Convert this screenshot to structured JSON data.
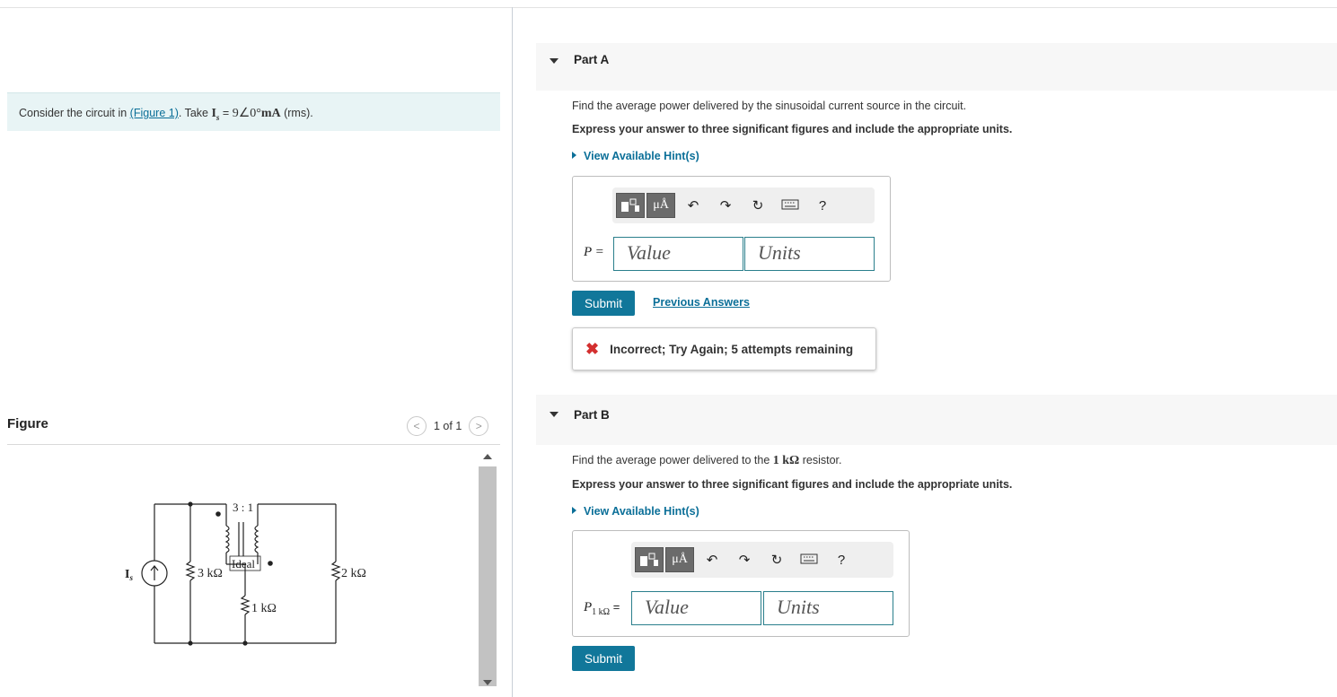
{
  "problem": {
    "intro": "Consider the circuit in ",
    "figure_link": "(Figure 1)",
    "take": ". Take ",
    "symbol": "I",
    "symbol_sub": "s",
    "equals": " = ",
    "phasor": "9∠0°",
    "unit": "mA",
    "rms": " (rms)."
  },
  "figure": {
    "title": "Figure",
    "pager_text": "1 of 1",
    "prev_glyph": "<",
    "next_glyph": ">",
    "circuit_labels": {
      "source": "I",
      "source_sub": "s",
      "r1": "3 kΩ",
      "ratio": "3 : 1",
      "ideal": "Ideal",
      "r2": "2 kΩ",
      "r3": "1 kΩ"
    }
  },
  "partA": {
    "title": "Part A",
    "question": "Find the average power delivered by the sinusoidal current source in the circuit.",
    "express": "Express your answer to three significant figures and include the appropriate units.",
    "hint": "View Available Hint(s)",
    "var_label": "P =",
    "value_placeholder": "Value",
    "units_placeholder": "Units",
    "submit": "Submit",
    "previous_answers": "Previous Answers",
    "feedback_icon": "✖",
    "feedback": "Incorrect; Try Again; 5 attempts remaining"
  },
  "partB": {
    "title": "Part B",
    "question_pre": "Find the average power delivered to the ",
    "question_math": "1 kΩ",
    "question_post": " resistor.",
    "express": "Express your answer to three significant figures and include the appropriate units.",
    "hint": "View Available Hint(s)",
    "var_main": "P",
    "var_sub": "1 kΩ",
    "var_eq": " =",
    "value_placeholder": "Value",
    "units_placeholder": "Units",
    "submit": "Submit"
  },
  "toolbar": {
    "units_glyph": "μÅ",
    "undo_icon": "↶",
    "redo_icon": "↷",
    "reset_icon": "↻",
    "help": "?"
  }
}
